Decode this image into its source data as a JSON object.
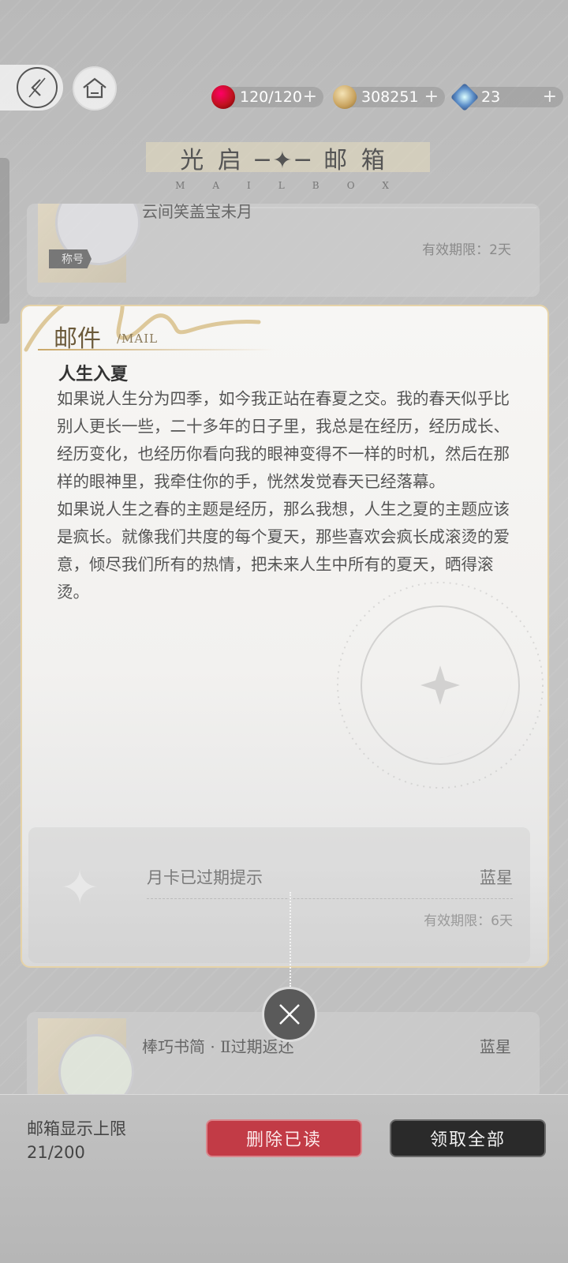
{
  "topbar": {
    "resources": [
      {
        "name": "energy-icon",
        "value": "120/120",
        "plus": "+"
      },
      {
        "name": "gold-coin-icon",
        "value": "308251",
        "plus": "+"
      },
      {
        "name": "diamond-icon",
        "value": "23",
        "plus": "+"
      }
    ]
  },
  "header": {
    "title": "光 启 ─✦─ 邮 箱",
    "subtitle": "MAILBOX"
  },
  "mail_list": {
    "top_card": {
      "badge": "称号",
      "subject_partial": "云间笑盖宝未月",
      "expiry": "有效期限：2天"
    },
    "bottom_card": {
      "subject": "棒巧书简 · Ⅱ过期返还",
      "sender": "蓝星"
    }
  },
  "mail": {
    "header_label": "邮件",
    "header_sub": "/MAIL",
    "subject": "人生入夏",
    "body": [
      "如果说人生分为四季，如今我正站在春夏之交。我的春天似乎比别人更长一些，二十多年的日子里，我总是在经历，经历成长、经历变化，也经历你看向我的眼神变得不一样的时机，然后在那样的眼神里，我牵住你的手，恍然发觉春天已经落幕。",
      "如果说人生之春的主题是经历，那么我想，人生之夏的主题应该是疯长。就像我们共度的每个夏天，那些喜欢会疯长成滚烫的爱意，倾尽我们所有的热情，把未来人生中所有的夏天，晒得滚烫。"
    ],
    "sub_card": {
      "subject": "月卡已过期提示",
      "sender": "蓝星",
      "expiry": "有效期限：6天"
    }
  },
  "footer": {
    "limit_label": "邮箱显示上限",
    "limit_count": "21/200",
    "delete_read": "删除已读",
    "claim_all": "领取全部"
  }
}
